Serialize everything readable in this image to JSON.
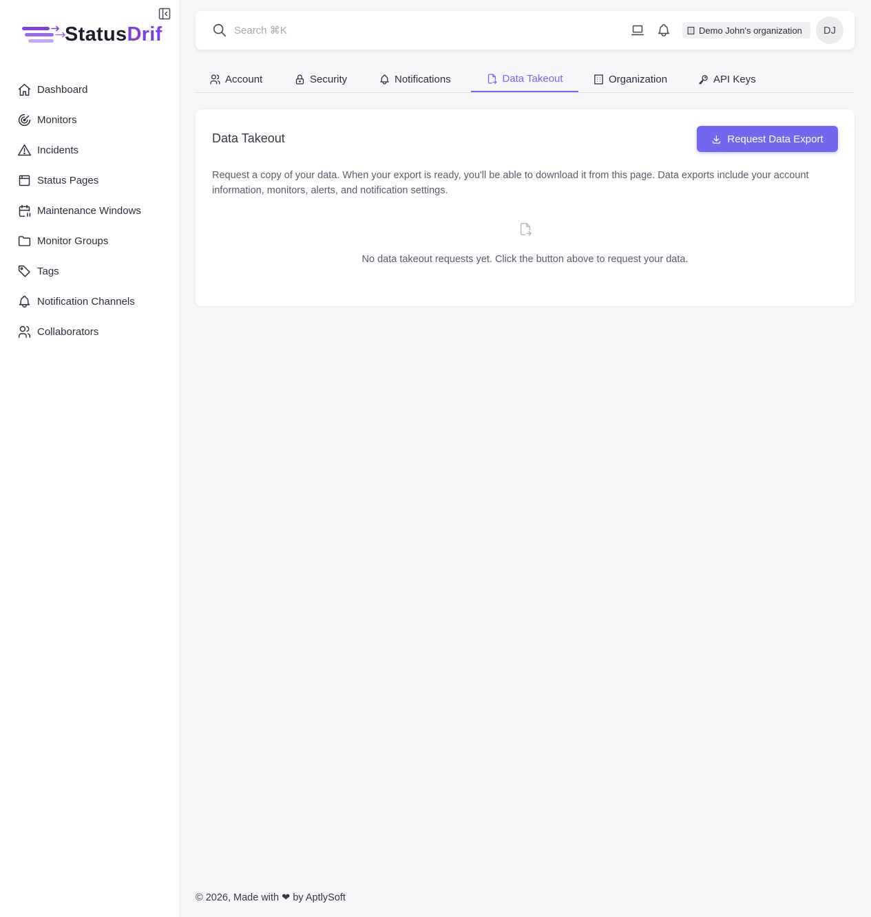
{
  "brand": {
    "name_part1": "Status",
    "name_part2": "Drif",
    "accent_color": "#7b3fe4"
  },
  "sidebar": {
    "items": [
      {
        "label": "Dashboard",
        "icon": "home-icon"
      },
      {
        "label": "Monitors",
        "icon": "radar-icon"
      },
      {
        "label": "Incidents",
        "icon": "alert-triangle-icon"
      },
      {
        "label": "Status Pages",
        "icon": "browser-icon"
      },
      {
        "label": "Maintenance Windows",
        "icon": "calendar-pause-icon"
      },
      {
        "label": "Monitor Groups",
        "icon": "folder-icon"
      },
      {
        "label": "Tags",
        "icon": "tag-icon"
      },
      {
        "label": "Notification Channels",
        "icon": "bell-icon"
      },
      {
        "label": "Collaborators",
        "icon": "users-icon"
      }
    ]
  },
  "topbar": {
    "search_placeholder": "Search ⌘K",
    "organization": "Demo John's organization",
    "avatar_initials": "DJ"
  },
  "tabs": [
    {
      "label": "Account",
      "icon": "users-icon",
      "active": false
    },
    {
      "label": "Security",
      "icon": "lock-icon",
      "active": false
    },
    {
      "label": "Notifications",
      "icon": "bell-icon",
      "active": false
    },
    {
      "label": "Data Takeout",
      "icon": "file-export-icon",
      "active": true
    },
    {
      "label": "Organization",
      "icon": "building-icon",
      "active": false
    },
    {
      "label": "API Keys",
      "icon": "key-icon",
      "active": false
    }
  ],
  "card": {
    "title": "Data Takeout",
    "button_label": "Request Data Export",
    "description": "Request a copy of your data. When your export is ready, you'll be able to download it from this page. Data exports include your account information, monitors, alerts, and notification settings.",
    "empty_message": "No data takeout requests yet. Click the button above to request your data."
  },
  "footer": {
    "text": "© 2026, Made with ❤ by AptlySoft"
  },
  "colors": {
    "primary": "#7367f0",
    "background": "#f7f7f9"
  }
}
